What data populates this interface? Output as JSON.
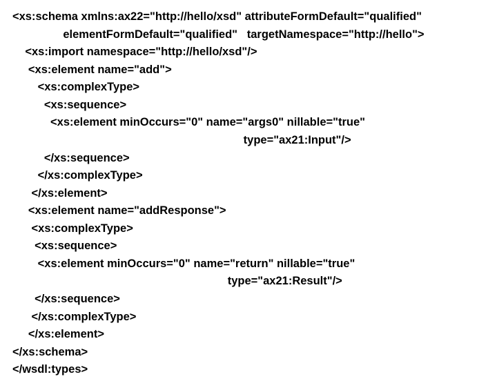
{
  "lines": [
    "<xs:schema xmlns:ax22=\"http://hello/xsd\" attributeFormDefault=\"qualified\"",
    "                elementFormDefault=\"qualified\"   targetNamespace=\"http://hello\">",
    "    <xs:import namespace=\"http://hello/xsd\"/>",
    "     <xs:element name=\"add\">",
    "        <xs:complexType>",
    "          <xs:sequence>",
    "            <xs:element minOccurs=\"0\" name=\"args0\" nillable=\"true\"",
    "                                                                         type=\"ax21:Input\"/>",
    "          </xs:sequence>",
    "        </xs:complexType>",
    "      </xs:element>",
    "     <xs:element name=\"addResponse\">",
    "      <xs:complexType>",
    "       <xs:sequence>",
    "        <xs:element minOccurs=\"0\" name=\"return\" nillable=\"true\"",
    "                                                                    type=\"ax21:Result\"/>",
    "       </xs:sequence>",
    "      </xs:complexType>",
    "     </xs:element>",
    "</xs:schema>",
    "</wsdl:types>"
  ]
}
